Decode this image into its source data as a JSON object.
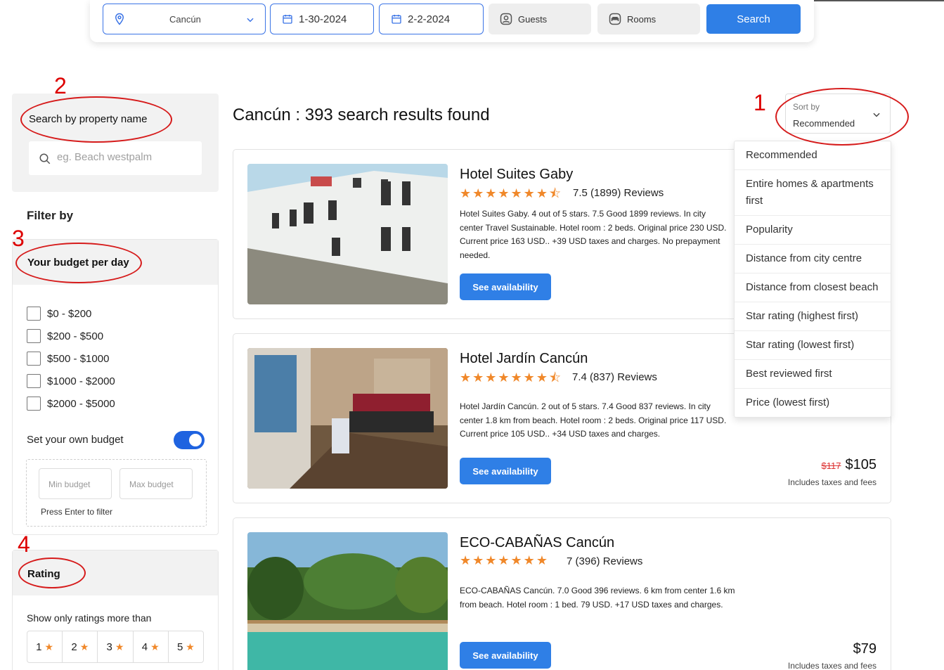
{
  "search": {
    "location": "Cancún",
    "check_in": "1-30-2024",
    "check_out": "2-2-2024",
    "guests": "Guests",
    "rooms": "Rooms",
    "button": "Search"
  },
  "sidebar": {
    "property_title": "Search by property name",
    "property_placeholder": "eg. Beach westpalm",
    "filter_by": "Filter by",
    "budget": {
      "title": "Your budget per day",
      "ranges": [
        "$0 - $200",
        "$200 - $500",
        "$500 - $1000",
        "$1000 - $2000",
        "$2000 - $5000"
      ],
      "own_label": "Set your own budget",
      "own_enabled": true,
      "min_placeholder": "Min budget",
      "max_placeholder": "Max budget",
      "press_enter": "Press Enter to filter"
    },
    "rating": {
      "title": "Rating",
      "show_label": "Show only ratings more than",
      "options": [
        "1",
        "2",
        "3",
        "4",
        "5"
      ]
    }
  },
  "main": {
    "results_title": "Cancún : 393 search results found",
    "sort": {
      "label": "Sort by",
      "value": "Recommended",
      "options": [
        "Recommended",
        "Entire homes & apartments first",
        "Popularity",
        "Distance from city centre",
        "Distance from closest beach",
        "Star rating (highest first)",
        "Star rating (lowest first)",
        "Best reviewed first",
        "Price (lowest first)"
      ]
    },
    "hotels": [
      {
        "name": "Hotel Suites Gaby",
        "stars": "★★★★★★★⯪",
        "reviews": "7.5 (1899) Reviews",
        "description": "Hotel Suites Gaby. 4 out of 5 stars. 7.5 Good 1899 reviews. In city center Travel Sustainable. Hotel room : 2 beds. Original price 230 USD. Current price 163 USD.. +39 USD taxes and charges. No prepayment needed.",
        "button": "See availability"
      },
      {
        "name": "Hotel Jardín Cancún",
        "stars": "★★★★★★★⯪",
        "reviews": "7.4 (837) Reviews",
        "description": "Hotel Jardín Cancún. 2 out of 5 stars. 7.4 Good 837 reviews. In city center 1.8 km from beach. Hotel room : 2 beds. Original price 117 USD. Current price 105 USD.. +34 USD taxes and charges.",
        "button": "See availability",
        "old_price": "$117",
        "price": "$105",
        "taxes": "Includes taxes and fees"
      },
      {
        "name": "ECO-CABAÑAS Cancún",
        "stars": "★★★★★★★",
        "reviews": "7 (396) Reviews",
        "description": "ECO-CABAÑAS Cancún. 7.0 Good 396 reviews. 6 km from center 1.6 km from beach. Hotel room : 1 bed. 79 USD. +17 USD taxes and charges.",
        "button": "See availability",
        "price": "$79",
        "taxes": "Includes taxes and fees"
      }
    ]
  },
  "annotations": [
    "1",
    "2",
    "3",
    "4"
  ],
  "colors": {
    "accent": "#2f7fe6",
    "star": "#f0882a",
    "annotation": "#d61b1b"
  }
}
